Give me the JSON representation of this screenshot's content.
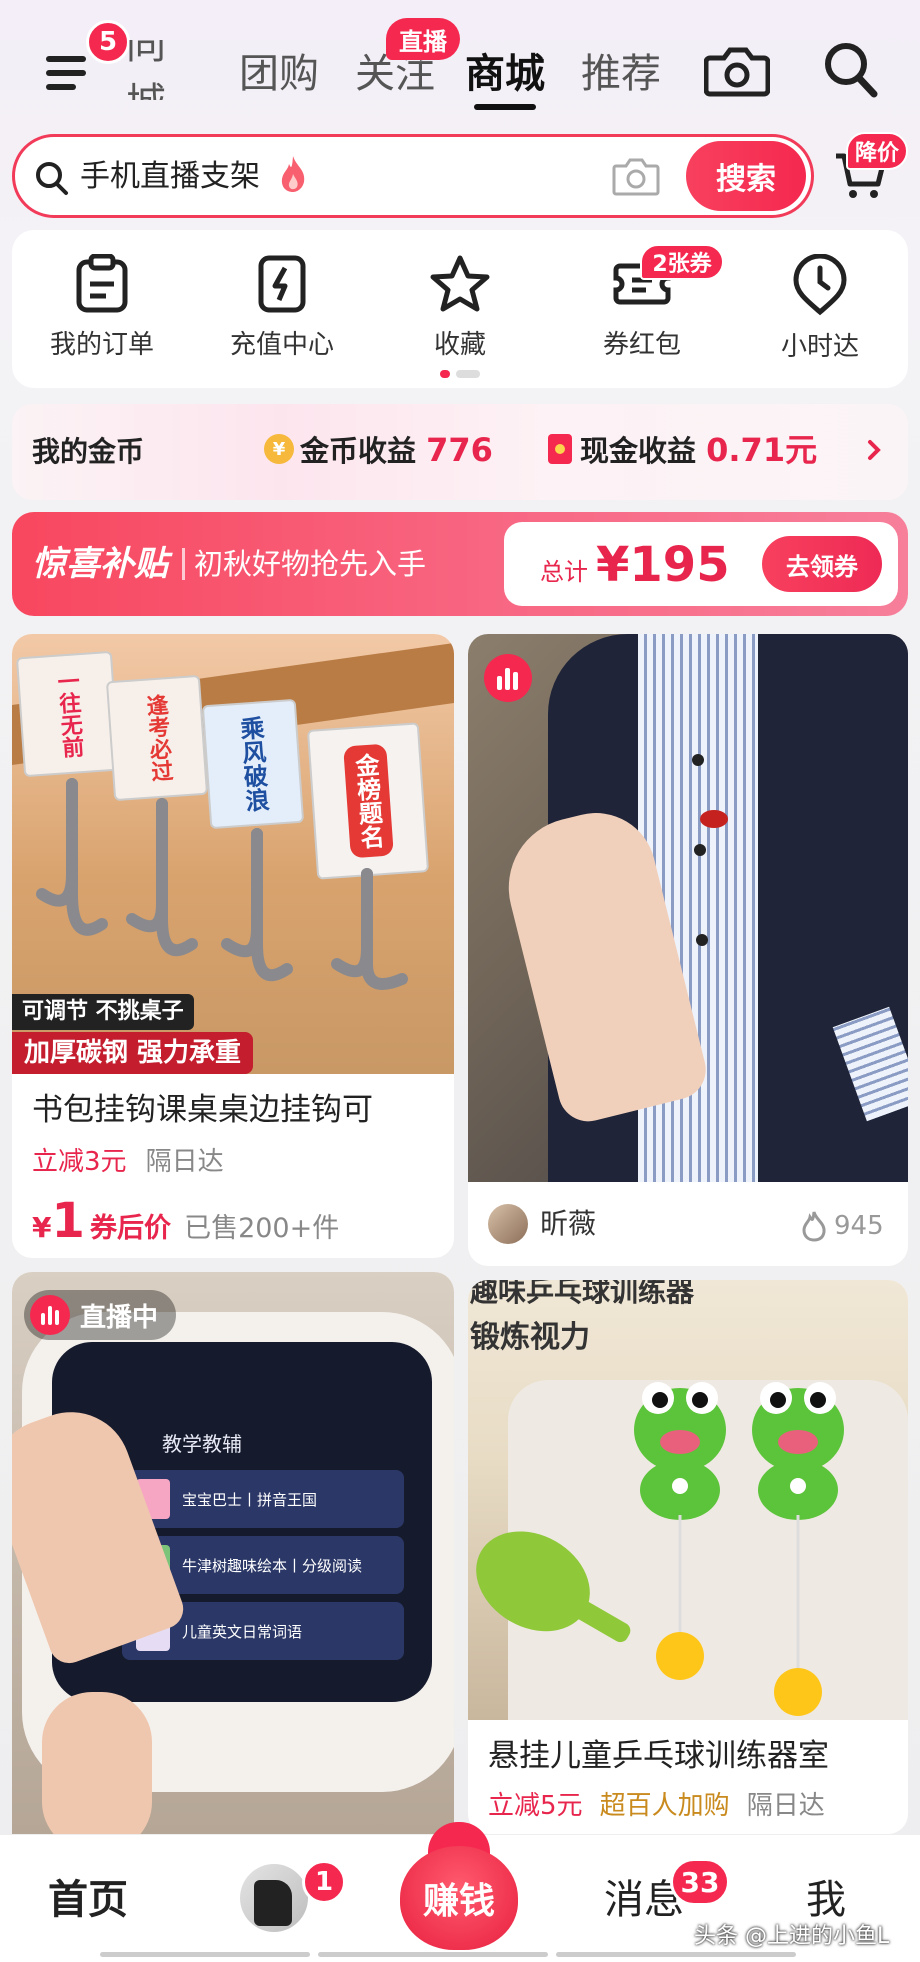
{
  "topnav": {
    "menu_badge": "5",
    "tabs": [
      {
        "label": "同城"
      },
      {
        "label": "团购"
      },
      {
        "label": "关注"
      },
      {
        "label": "商城"
      },
      {
        "label": "推荐"
      }
    ],
    "live_badge": "直播"
  },
  "search": {
    "query": "手机直播支架",
    "button": "搜索",
    "cart_badge": "降价"
  },
  "quick": {
    "items": [
      {
        "label": "我的订单",
        "icon": "clipboard-icon"
      },
      {
        "label": "充值中心",
        "icon": "phone-charge-icon"
      },
      {
        "label": "收藏",
        "icon": "star-icon"
      },
      {
        "label": "券红包",
        "icon": "coupon-icon",
        "badge": "2张券"
      },
      {
        "label": "小时达",
        "icon": "clock-pin-icon"
      }
    ]
  },
  "coins": {
    "title": "我的金币",
    "coin_label": "金币收益",
    "coin_value": "776",
    "cash_label": "现金收益",
    "cash_value": "0.71元"
  },
  "subsidy": {
    "title": "惊喜补贴",
    "subtitle": "初秋好物抢先入手",
    "total_label": "总计",
    "total_value": "¥195",
    "button": "去领券"
  },
  "products": {
    "p1": {
      "img_tag1": "可调节 不挑桌子",
      "img_tag2": "加厚碳钢 强力承重",
      "hook_labels": [
        "一往无前",
        "逢考必过",
        "乘风破浪",
        "金榜题名"
      ],
      "title": "书包挂钩课桌桌边挂钩可",
      "discount": "立减3元",
      "delivery": "隔日达",
      "price_symbol": "¥",
      "price": "1",
      "price_note": "券后价",
      "sold": "已售200+件"
    },
    "p2": {
      "author": "昕薇",
      "likes": "945"
    },
    "p3": {
      "live_tag": "直播中",
      "screen_title": "教学教辅",
      "screen_items": [
        "宝宝巴士丨拼音王国",
        "牛津树趣味绘本丨分级阅读",
        "儿童英文日常词语"
      ]
    },
    "p4": {
      "img_text1": "趣味乒乓球训练器",
      "img_text2": "锻炼视力",
      "title": "悬挂儿童乒乓球训练器室",
      "discount": "立减5元",
      "tag": "超百人加购",
      "delivery": "隔日达"
    }
  },
  "tabbar": {
    "home": "首页",
    "friend_badge": "1",
    "earn": "赚钱",
    "messages": "消息",
    "messages_badge": "33",
    "me": "我",
    "watermark": "头条 @上进的小鱼L"
  },
  "colors": {
    "accent": "#f5284f",
    "price_red": "#e8264d",
    "gold": "#c98a1e"
  }
}
